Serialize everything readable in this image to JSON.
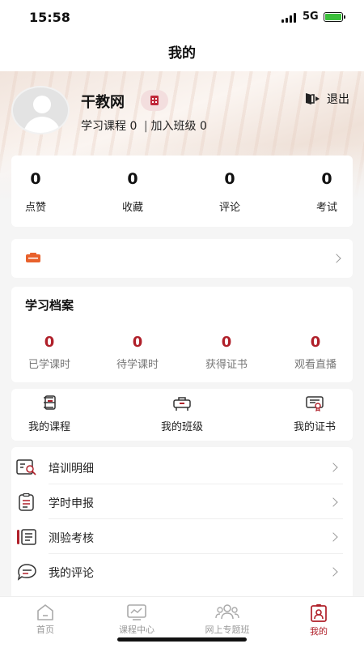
{
  "status_bar": {
    "time": "15:58",
    "network": "5G"
  },
  "nav": {
    "title": "我的"
  },
  "profile": {
    "name": "干教网",
    "courses_label": "学习课程",
    "courses_count": "0",
    "classes_label": "加入班级",
    "classes_count": "0",
    "logout_label": "退出"
  },
  "stats": [
    {
      "value": "0",
      "label": "点赞"
    },
    {
      "value": "0",
      "label": "收藏"
    },
    {
      "value": "0",
      "label": "评论"
    },
    {
      "value": "0",
      "label": "考试"
    }
  ],
  "archive": {
    "title": "学习档案",
    "items": [
      {
        "value": "0",
        "label": "已学课时"
      },
      {
        "value": "0",
        "label": "待学课时"
      },
      {
        "value": "0",
        "label": "获得证书"
      },
      {
        "value": "0",
        "label": "观看直播"
      }
    ]
  },
  "quick_links": [
    {
      "label": "我的课程",
      "icon": "course-icon"
    },
    {
      "label": "我的班级",
      "icon": "class-icon"
    },
    {
      "label": "我的证书",
      "icon": "certificate-icon"
    }
  ],
  "menu": [
    {
      "label": "培训明细",
      "icon": "training-detail-icon"
    },
    {
      "label": "学时申报",
      "icon": "hours-report-icon"
    },
    {
      "label": "测验考核",
      "icon": "quiz-icon"
    },
    {
      "label": "我的评论",
      "icon": "comment-icon"
    }
  ],
  "tabs": [
    {
      "label": "首页",
      "icon": "home-icon",
      "active": false
    },
    {
      "label": "课程中心",
      "icon": "course-center-icon",
      "active": false
    },
    {
      "label": "网上专题班",
      "icon": "topic-class-icon",
      "active": false
    },
    {
      "label": "我的",
      "icon": "profile-icon",
      "active": true
    }
  ],
  "colors": {
    "accent": "#b0202a",
    "background": "#f5f5f5"
  }
}
